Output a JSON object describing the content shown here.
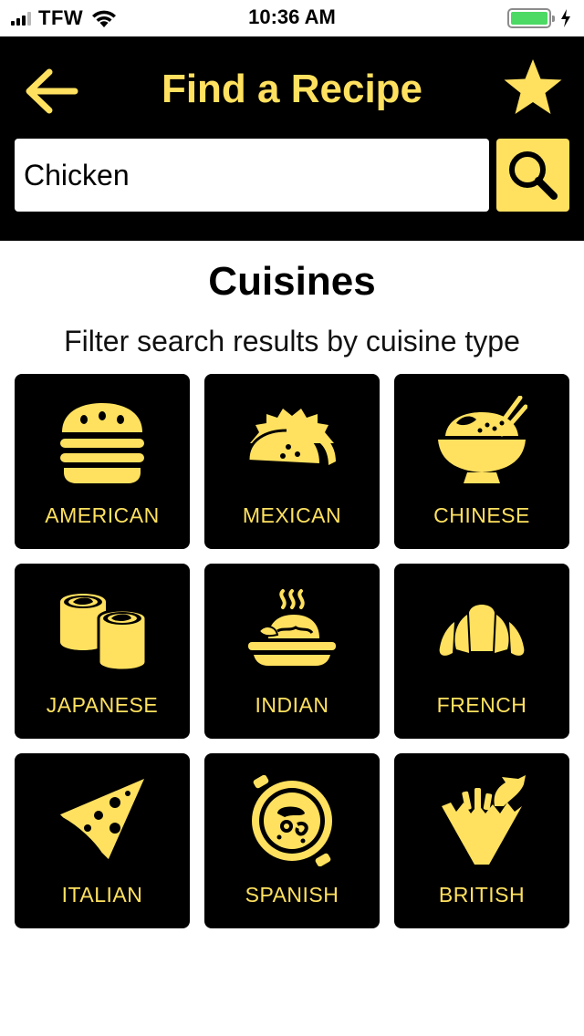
{
  "status_bar": {
    "carrier": "TFW",
    "time": "10:36 AM",
    "battery_level": 1.0,
    "icons": [
      "signal-icon",
      "wifi-icon",
      "battery-icon",
      "charging-icon"
    ]
  },
  "header": {
    "title": "Find a Recipe",
    "back_icon": "arrow-left-icon",
    "favorite_icon": "star-icon",
    "search": {
      "value": "Chicken",
      "placeholder": "",
      "button_icon": "search-icon"
    }
  },
  "cuisines": {
    "title": "Cuisines",
    "subtitle": "Filter search results by cuisine type",
    "items": [
      {
        "label": "AMERICAN",
        "icon": "burger-icon"
      },
      {
        "label": "MEXICAN",
        "icon": "taco-icon"
      },
      {
        "label": "CHINESE",
        "icon": "rice-bowl-icon"
      },
      {
        "label": "JAPANESE",
        "icon": "sushi-icon"
      },
      {
        "label": "INDIAN",
        "icon": "curry-icon"
      },
      {
        "label": "FRENCH",
        "icon": "croissant-icon"
      },
      {
        "label": "ITALIAN",
        "icon": "pizza-icon"
      },
      {
        "label": "SPANISH",
        "icon": "paella-icon"
      },
      {
        "label": "BRITISH",
        "icon": "fish-and-chips-icon"
      }
    ]
  },
  "colors": {
    "accent": "#ffe15f",
    "header_bg": "#000000",
    "tile_bg": "#000000",
    "battery": "#4cd964"
  }
}
